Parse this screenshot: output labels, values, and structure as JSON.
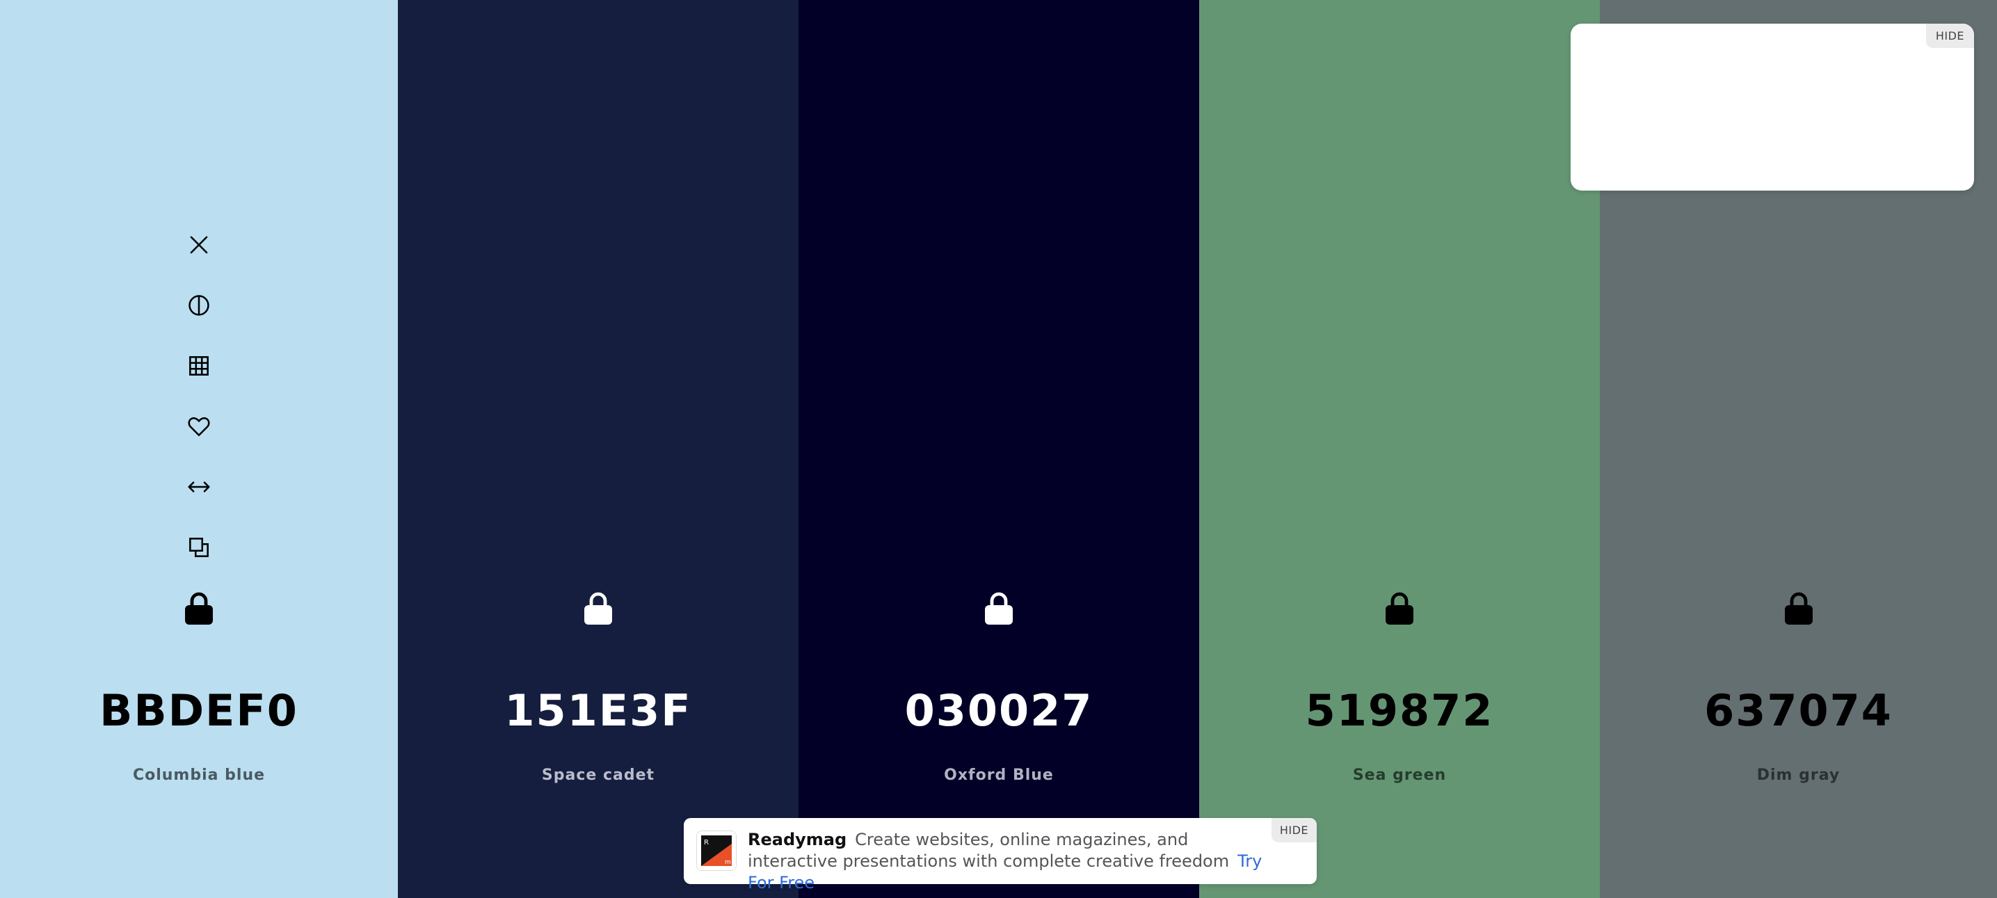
{
  "palette": {
    "colors": [
      {
        "hex": "BBDEF0",
        "name": "Columbia blue",
        "bg": "#BBDEF0",
        "text_color": "#000000",
        "name_color": "#4a5a62"
      },
      {
        "hex": "151E3F",
        "name": "Space cadet",
        "bg": "#151E3F",
        "text_color": "#ffffff",
        "name_color": "#b9bccb"
      },
      {
        "hex": "030027",
        "name": "Oxford Blue",
        "bg": "#030027",
        "text_color": "#ffffff",
        "name_color": "#b3b2c2"
      },
      {
        "hex": "519872",
        "name": "Sea green",
        "bg": "#519872",
        "text_color": "#000000",
        "name_color": "#243d2e"
      },
      {
        "hex": "637074",
        "name": "Dim gray",
        "bg": "#637074",
        "text_color": "#000000",
        "name_color": "#2a3133"
      }
    ],
    "swatch_widths": [
      572,
      576,
      576,
      576,
      571
    ],
    "tools": [
      "close-icon",
      "contrast-icon",
      "grid-icon",
      "heart-icon",
      "arrows-horizontal-icon",
      "copy-icon"
    ]
  },
  "ad_top": {
    "hide_label": "HIDE"
  },
  "ad_bottom": {
    "hide_label": "HIDE",
    "brand": "Readymag",
    "text": "Create websites, online magazines, and interactive presentations with complete creative freedom",
    "cta": "Try For Free",
    "cta_color": "#2f6bd8"
  }
}
